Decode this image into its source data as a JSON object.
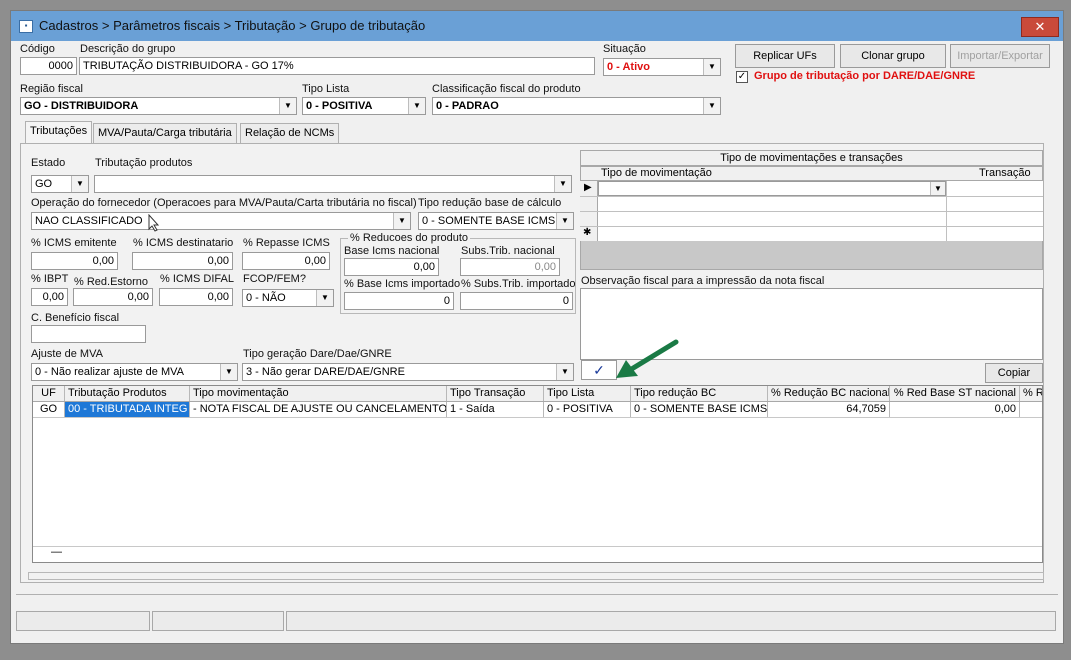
{
  "window": {
    "title": "Cadastros > Parâmetros fiscais > Tributação > Grupo de tributação",
    "close_glyph": "✕"
  },
  "header": {
    "codigo_label": "Código",
    "codigo_value": "0000",
    "descricao_label": "Descrição do grupo",
    "descricao_value": "TRIBUTAÇÃO DISTRIBUIDORA - GO 17%",
    "situacao_label": "Situação",
    "situacao_value": "0 - Ativo",
    "replicar_label": "Replicar UFs",
    "clonar_label": "Clonar grupo",
    "importar_label": "Importar/Exportar",
    "dare_checkbox_label": "Grupo de tributação por DARE/DAE/GNRE",
    "dare_checked": "✓",
    "regiao_label": "Região fiscal",
    "regiao_value": "GO - DISTRIBUIDORA",
    "tipo_lista_label": "Tipo Lista",
    "tipo_lista_value": "0 - POSITIVA",
    "classificacao_label": "Classificação fiscal do produto",
    "classificacao_value": "0 - PADRAO"
  },
  "tabs": [
    {
      "label": "Tributações"
    },
    {
      "label": "MVA/Pauta/Carga tributária"
    },
    {
      "label": "Relação de NCMs"
    }
  ],
  "form": {
    "estado_label": "Estado",
    "estado_value": "GO",
    "tributacao_label": "Tributação produtos",
    "tributacao_value": "",
    "operacao_label": "Operação do fornecedor (Operacoes para MVA/Pauta/Carta tributária no fiscal)",
    "operacao_value": "NAO CLASSIFICADO",
    "tipo_reducao_label": "Tipo redução base de cálculo",
    "tipo_reducao_value": "0 - SOMENTE BASE ICMS",
    "icms_emitente_label": "% ICMS emitente",
    "icms_emitente_value": "0,00",
    "icms_destinatario_label": "% ICMS destinatario",
    "icms_destinatario_value": "0,00",
    "repasse_icms_label": "% Repasse ICMS",
    "repasse_icms_value": "0,00",
    "reducoes_group_label": "% Reducoes do produto",
    "base_icms_nacional_label": "Base Icms nacional",
    "base_icms_nacional_value": "0,00",
    "subs_trib_nacional_label": "Subs.Trib. nacional",
    "subs_trib_nacional_value": "0,00",
    "ibpt_label": "% IBPT",
    "ibpt_value": "0,00",
    "red_estorno_label": "% Red.Estorno",
    "red_estorno_value": "0,00",
    "icms_difal_label": "% ICMS DIFAL",
    "icms_difal_value": "0,00",
    "fcop_label": "FCOP/FEM?",
    "fcop_value": "0 - NÃO",
    "base_icms_importado_label": "% Base Icms importado",
    "base_icms_importado_value": "0",
    "subs_trib_importado_label": "% Subs.Trib. importado",
    "subs_trib_importado_value": "0",
    "beneficio_label": "C. Benefício fiscal",
    "beneficio_value": "",
    "ajuste_mva_label": "Ajuste de MVA",
    "ajuste_mva_value": "0 - Não realizar ajuste de MVA",
    "tipo_geracao_label": "Tipo geração Dare/Dae/GNRE",
    "tipo_geracao_value": "3 - Não gerar DARE/DAE/GNRE",
    "confirm_glyph": "✓"
  },
  "movimentacoes": {
    "title": "Tipo de movimentações e transações",
    "col_tipo": "Tipo de movimentação",
    "col_transacao": "Transação",
    "current_marker": "▶",
    "new_marker": "✱"
  },
  "observacao": {
    "label": "Observação fiscal para a impressão da nota fiscal",
    "value": "",
    "copiar_label": "Copiar"
  },
  "table": {
    "headers": [
      "UF",
      "Tributação Produtos",
      "Tipo movimentação",
      "Tipo Transação",
      "Tipo Lista",
      "Tipo redução BC",
      "% Redução BC nacional",
      "% Red Base ST nacional",
      "% Re"
    ],
    "rows": [
      [
        "GO",
        "00 - TRIBUTADA INTEG",
        "- NOTA FISCAL DE AJUSTE OU CANCELAMENTO",
        "1 - Saída",
        "0 - POSITIVA",
        "0 - SOMENTE BASE ICMS",
        "64,7059",
        "0,00",
        ""
      ]
    ],
    "footer_mark": "—"
  },
  "colors": {
    "title_bar": "#6aa0d6",
    "close_button": "#c94a3a",
    "selected_cell": "#1e78d7",
    "active_red": "#e01010",
    "arrow_green": "#1a7a45"
  },
  "icons": [
    "app-icon",
    "close-icon",
    "dropdown-arrow-icon",
    "checkbox-icon",
    "checkmark-icon",
    "arrow-pointer-icon",
    "mouse-cursor-icon",
    "row-pointer-icon",
    "new-row-icon"
  ]
}
